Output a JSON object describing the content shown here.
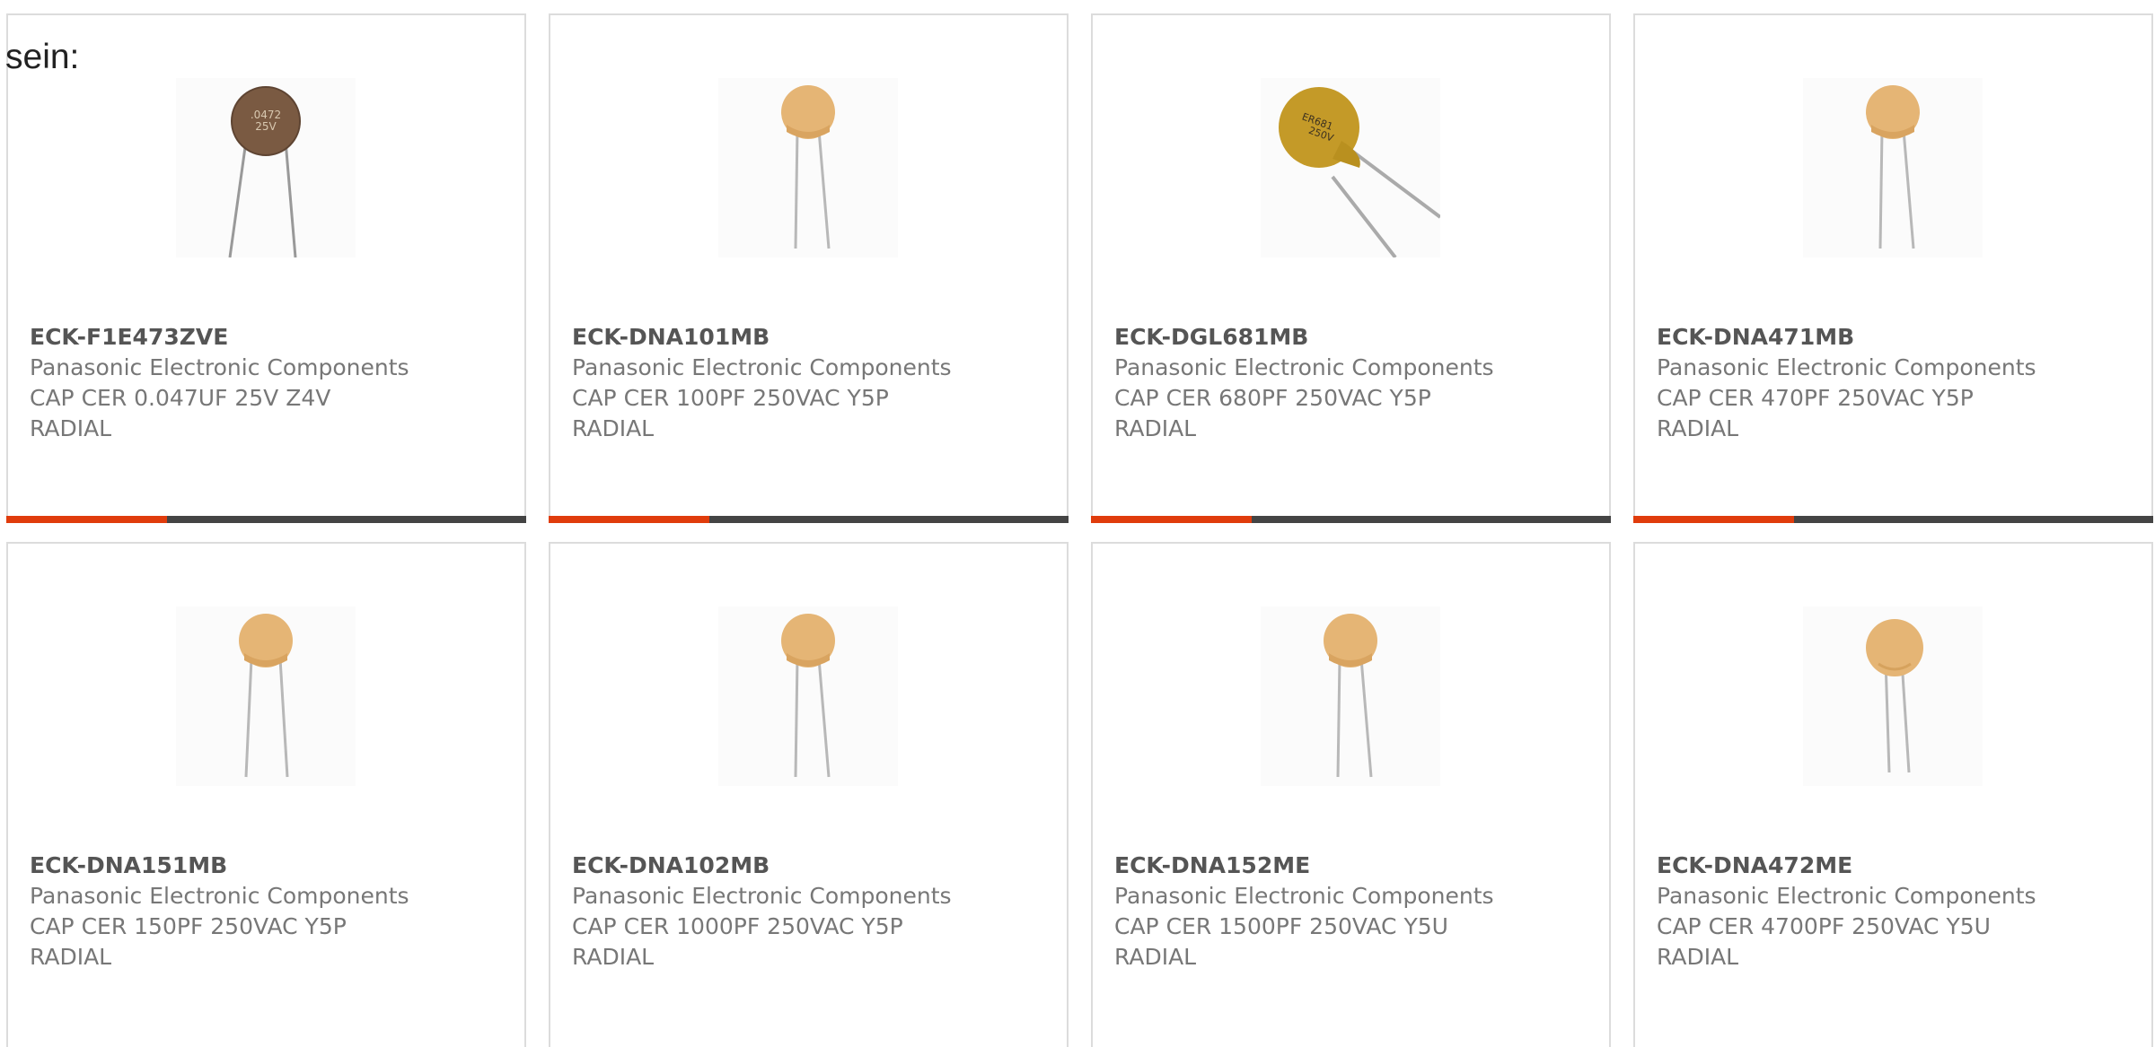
{
  "intro_text": "sein:",
  "colors": {
    "accent": "#e03c0c",
    "track": "#444444",
    "border": "#dcdcdc"
  },
  "products": [
    {
      "part_number": "ECK-F1E473ZVE",
      "manufacturer": "Panasonic Electronic Components",
      "description": "CAP CER 0.047UF 25V Z4V RADIAL",
      "image_icon": "brown-disc-capacitor-icon",
      "progress": 0.31
    },
    {
      "part_number": "ECK-DNA101MB",
      "manufacturer": "Panasonic Electronic Components",
      "description": "CAP CER 100PF 250VAC Y5P RADIAL",
      "image_icon": "tan-disc-capacitor-icon",
      "progress": 0.31
    },
    {
      "part_number": "ECK-DGL681MB",
      "manufacturer": "Panasonic Electronic Components",
      "description": "CAP CER 680PF 250VAC Y5P RADIAL",
      "image_icon": "yellow-disc-capacitor-icon",
      "progress": 0.31
    },
    {
      "part_number": "ECK-DNA471MB",
      "manufacturer": "Panasonic Electronic Components",
      "description": "CAP CER 470PF 250VAC Y5P RADIAL",
      "image_icon": "tan-disc-capacitor-icon",
      "progress": 0.31
    },
    {
      "part_number": "ECK-DNA151MB",
      "manufacturer": "Panasonic Electronic Components",
      "description": "CAP CER 150PF 250VAC Y5P RADIAL",
      "image_icon": "tan-disc-capacitor-icon"
    },
    {
      "part_number": "ECK-DNA102MB",
      "manufacturer": "Panasonic Electronic Components",
      "description": "CAP CER 1000PF 250VAC Y5P RADIAL",
      "image_icon": "tan-disc-capacitor-icon"
    },
    {
      "part_number": "ECK-DNA152ME",
      "manufacturer": "Panasonic Electronic Components",
      "description": "CAP CER 1500PF 250VAC Y5U RADIAL",
      "image_icon": "tan-disc-capacitor-icon"
    },
    {
      "part_number": "ECK-DNA472ME",
      "manufacturer": "Panasonic Electronic Components",
      "description": "CAP CER 4700PF 250VAC Y5U RADIAL",
      "image_icon": "tan-disc-capacitor-icon"
    }
  ]
}
